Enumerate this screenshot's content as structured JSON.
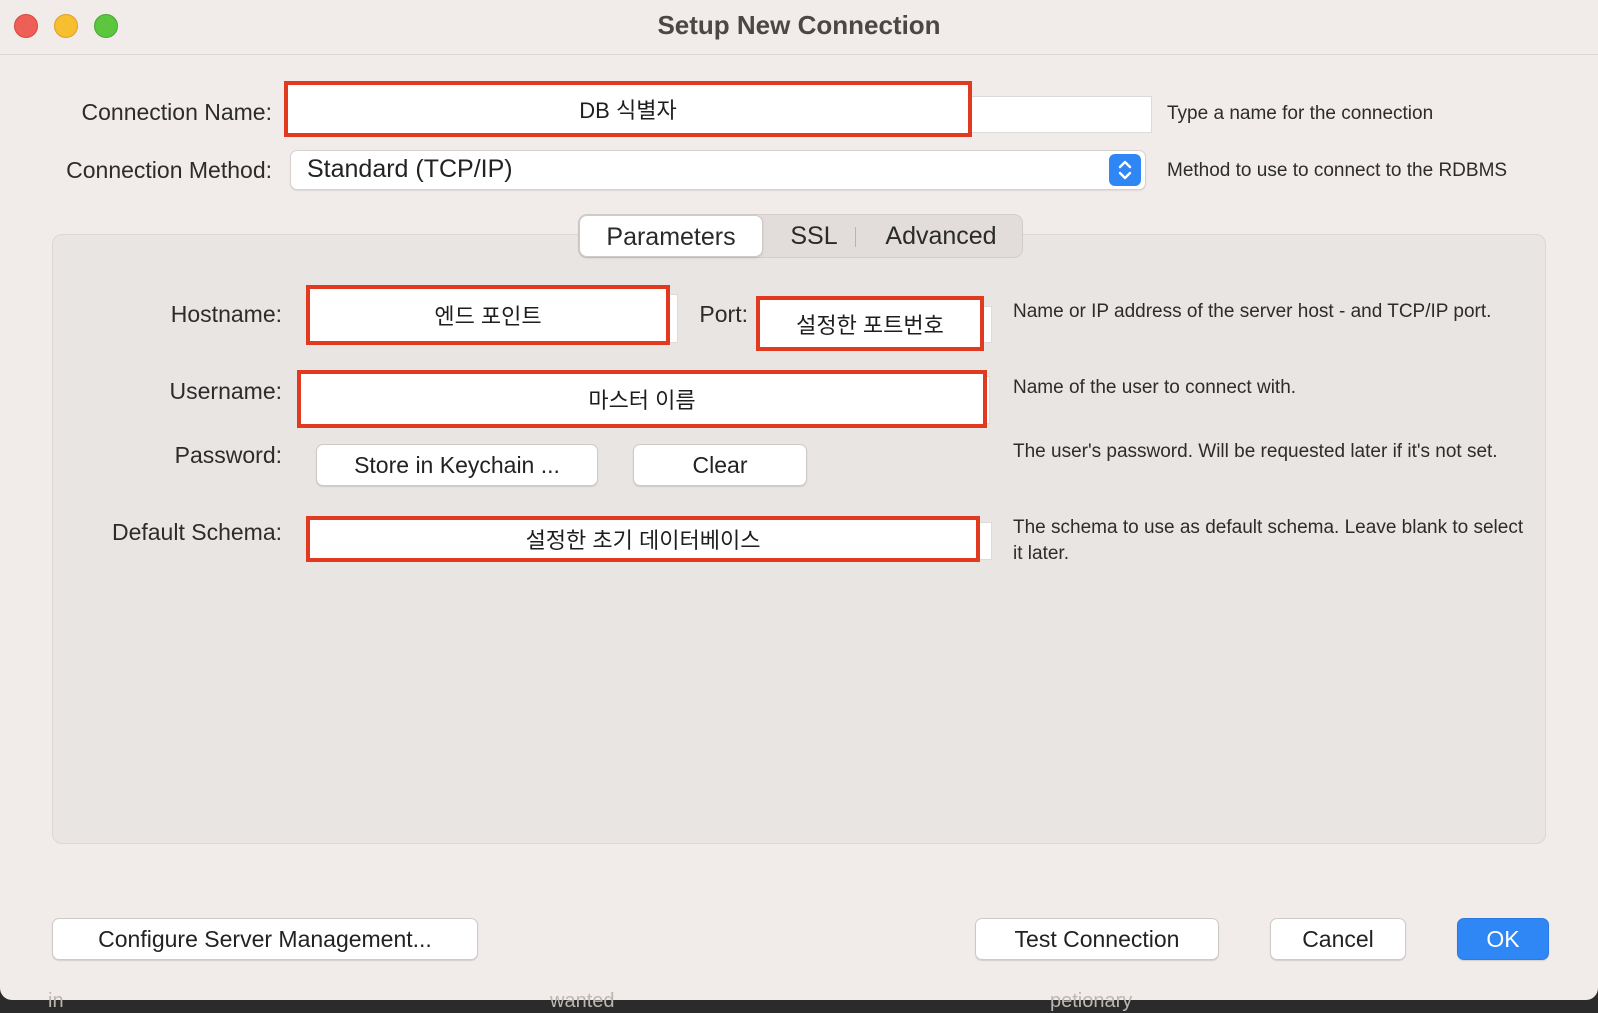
{
  "window": {
    "title": "Setup New Connection"
  },
  "connection_name": {
    "label": "Connection Name:",
    "value": "DB 식별자",
    "hint": "Type a name for the connection"
  },
  "connection_method": {
    "label": "Connection Method:",
    "value": "Standard (TCP/IP)",
    "hint": "Method to use to connect to the RDBMS"
  },
  "tabs": [
    {
      "label": "Parameters",
      "active": true
    },
    {
      "label": "SSL",
      "active": false
    },
    {
      "label": "Advanced",
      "active": false
    }
  ],
  "parameters": {
    "hostname": {
      "label": "Hostname:",
      "value": "엔드 포인트"
    },
    "port": {
      "label": "Port:",
      "value": "설정한 포트번호"
    },
    "hostname_hint": "Name or IP address of the server host - and TCP/IP port.",
    "username": {
      "label": "Username:",
      "value": "마스터 이름",
      "hint": "Name of the user to connect with."
    },
    "password": {
      "label": "Password:",
      "store_button": "Store in Keychain ...",
      "clear_button": "Clear",
      "hint": "The user's password. Will be requested later if it's not set."
    },
    "default_schema": {
      "label": "Default Schema:",
      "value": "설정한 초기 데이터베이스",
      "hint": "The schema to use as default schema. Leave blank to select it later."
    }
  },
  "footer": {
    "configure_button": "Configure Server Management...",
    "test_button": "Test Connection",
    "cancel_button": "Cancel",
    "ok_button": "OK"
  },
  "backdrop": {
    "texts": [
      "in",
      "wanted",
      "petionary"
    ]
  },
  "colors": {
    "highlight": "#e23a21",
    "accent": "#2f86f5"
  }
}
